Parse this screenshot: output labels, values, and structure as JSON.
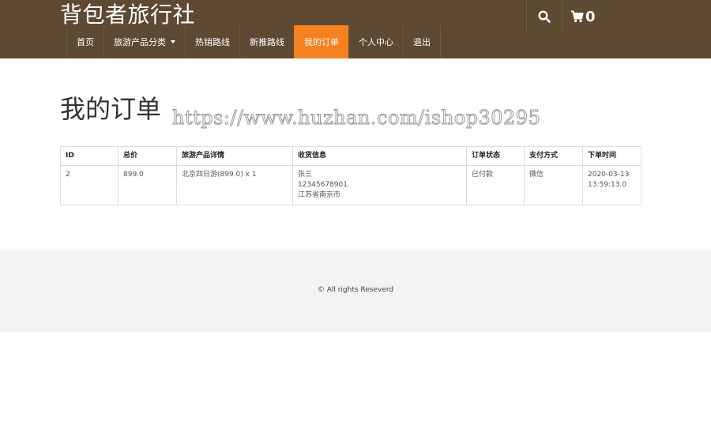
{
  "site": {
    "logo": "背包者旅行社"
  },
  "header": {
    "cart_count": "0"
  },
  "nav": {
    "items": [
      {
        "label": "首页"
      },
      {
        "label": "旅游产品分类"
      },
      {
        "label": "热销路线"
      },
      {
        "label": "新推路线"
      },
      {
        "label": "我的订单"
      },
      {
        "label": "个人中心"
      },
      {
        "label": "退出"
      }
    ]
  },
  "page": {
    "title": "我的订单",
    "watermark": "https://www.huzhan.com/ishop30295"
  },
  "orders": {
    "headers": [
      "ID",
      "总价",
      "旅游产品详情",
      "收货信息",
      "订单状态",
      "支付方式",
      "下单时间"
    ],
    "rows": [
      {
        "id": "2",
        "total": "899.0",
        "product": "北京四日游(899.0) x 1",
        "receiver_name": "张三",
        "receiver_phone": "12345678901",
        "receiver_address": "江苏省南京市",
        "status": "已付款",
        "payment": "微信",
        "date": "2020-03-13",
        "time": "13:59:13.0"
      }
    ]
  },
  "footer": {
    "copyright": "© All rights Reseverd"
  },
  "colors": {
    "header_bg": "#5e4a32",
    "active_nav": "#f5821f",
    "status_paid": "#e02222",
    "footer_bg": "#f1f3f4"
  },
  "icons": {
    "search": "search-icon",
    "cart": "cart-icon"
  }
}
